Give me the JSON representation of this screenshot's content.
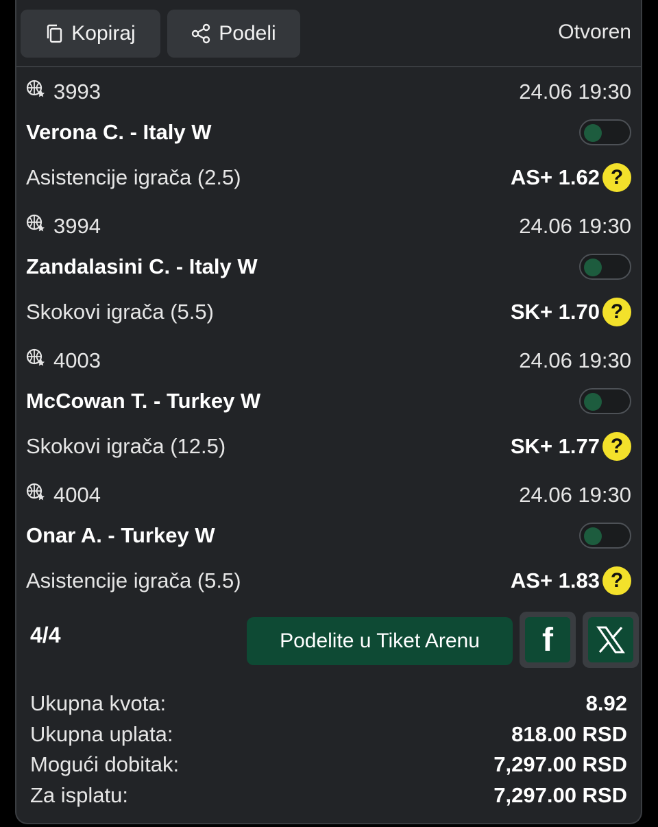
{
  "header": {
    "copy_label": "Kopiraj",
    "share_label": "Podeli",
    "status": "Otvoren"
  },
  "bets": [
    {
      "code": "3993",
      "datetime": "24.06 19:30",
      "match": "Verona C. - Italy W",
      "market": "Asistencije igrača (2.5)",
      "pick_odds": "AS+ 1.62",
      "help": "?"
    },
    {
      "code": "3994",
      "datetime": "24.06 19:30",
      "match": "Zandalasini C. - Italy W",
      "market": "Skokovi igrača (5.5)",
      "pick_odds": "SK+ 1.70",
      "help": "?"
    },
    {
      "code": "4003",
      "datetime": "24.06 19:30",
      "match": "McCowan T. - Turkey W",
      "market": "Skokovi igrača (12.5)",
      "pick_odds": "SK+ 1.77",
      "help": "?"
    },
    {
      "code": "4004",
      "datetime": "24.06 19:30",
      "match": "Onar A. - Turkey W",
      "market": "Asistencije igrača (5.5)",
      "pick_odds": "AS+ 1.83",
      "help": "?"
    }
  ],
  "footer": {
    "count": "4/4",
    "share_arena_label": "Podelite u Tiket Arenu",
    "facebook_glyph": "f"
  },
  "summary": [
    {
      "label": "Ukupna kvota:",
      "value": "8.92"
    },
    {
      "label": "Ukupna uplata:",
      "value": "818.00 RSD"
    },
    {
      "label": "Mogući dobitak:",
      "value": "7,297.00 RSD"
    },
    {
      "label": "Za isplatu:",
      "value": "7,297.00 RSD"
    }
  ],
  "colors": {
    "accent_green": "#0e4a34",
    "help_yellow": "#f3e12b",
    "panel_bg": "#222427"
  },
  "icons": {
    "copy": "copy-icon",
    "share": "share-icon",
    "sport": "basketball-icon",
    "facebook": "facebook-icon",
    "x": "x-logo-icon"
  }
}
